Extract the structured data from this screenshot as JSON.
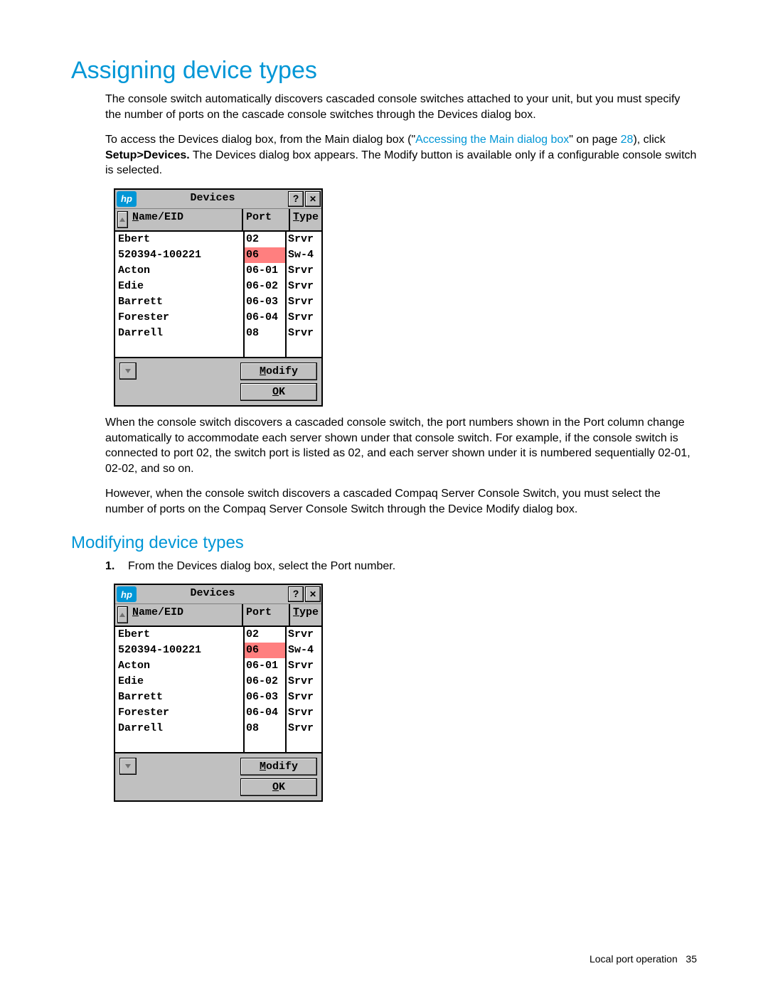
{
  "page": {
    "footer_text": "Local port operation",
    "page_number": "35"
  },
  "section": {
    "title": "Assigning device types",
    "p1": "The console switch automatically discovers cascaded console switches attached to your unit, but you must specify the number of ports on the cascade console switches through the Devices dialog box.",
    "p2_pre": "To access the Devices dialog box, from the Main dialog box (\"",
    "p2_link": "Accessing the Main dialog box",
    "p2_mid": "\" on page ",
    "p2_pageref": "28",
    "p2_post1": "), click ",
    "p2_bold": "Setup>Devices.",
    "p2_post2": " The Devices dialog box appears. The Modify button is available only if a configurable console switch is selected.",
    "p3": "When the console switch discovers a cascaded console switch, the port numbers shown in the Port column change automatically to accommodate each server shown under that console switch. For example, if the console switch is connected to port 02, the switch port is listed as 02, and each server shown under it is numbered sequentially 02-01, 02-02, and so on.",
    "p4": "However, when the console switch discovers a cascaded Compaq Server Console Switch, you must select the number of ports on the Compaq Server Console Switch through the Device Modify dialog box."
  },
  "subsection": {
    "title": "Modifying device types",
    "step1": "From the Devices dialog box, select the Port number."
  },
  "dialog": {
    "brand": "hp",
    "title": "Devices",
    "headers": {
      "name_u": "N",
      "name_rest": "ame/EID",
      "port": "Port",
      "type_u": "T",
      "type_rest": "ype"
    },
    "rows": [
      {
        "name": "Ebert",
        "port": "02",
        "type": "Srvr",
        "hl": false
      },
      {
        "name": "520394-100221",
        "port": "06",
        "type": "Sw-4",
        "hl": true
      },
      {
        "name": "Acton",
        "port": "06-01",
        "type": "Srvr",
        "hl": false
      },
      {
        "name": "Edie",
        "port": "06-02",
        "type": "Srvr",
        "hl": false
      },
      {
        "name": "Barrett",
        "port": "06-03",
        "type": "Srvr",
        "hl": false
      },
      {
        "name": "Forester",
        "port": "06-04",
        "type": "Srvr",
        "hl": false
      },
      {
        "name": "Darrell",
        "port": "08",
        "type": "Srvr",
        "hl": false
      },
      {
        "name": "",
        "port": "",
        "type": "",
        "hl": false
      }
    ],
    "buttons": {
      "modify_u": "M",
      "modify_rest": "odify",
      "ok_u": "O",
      "ok_rest": "K"
    }
  }
}
